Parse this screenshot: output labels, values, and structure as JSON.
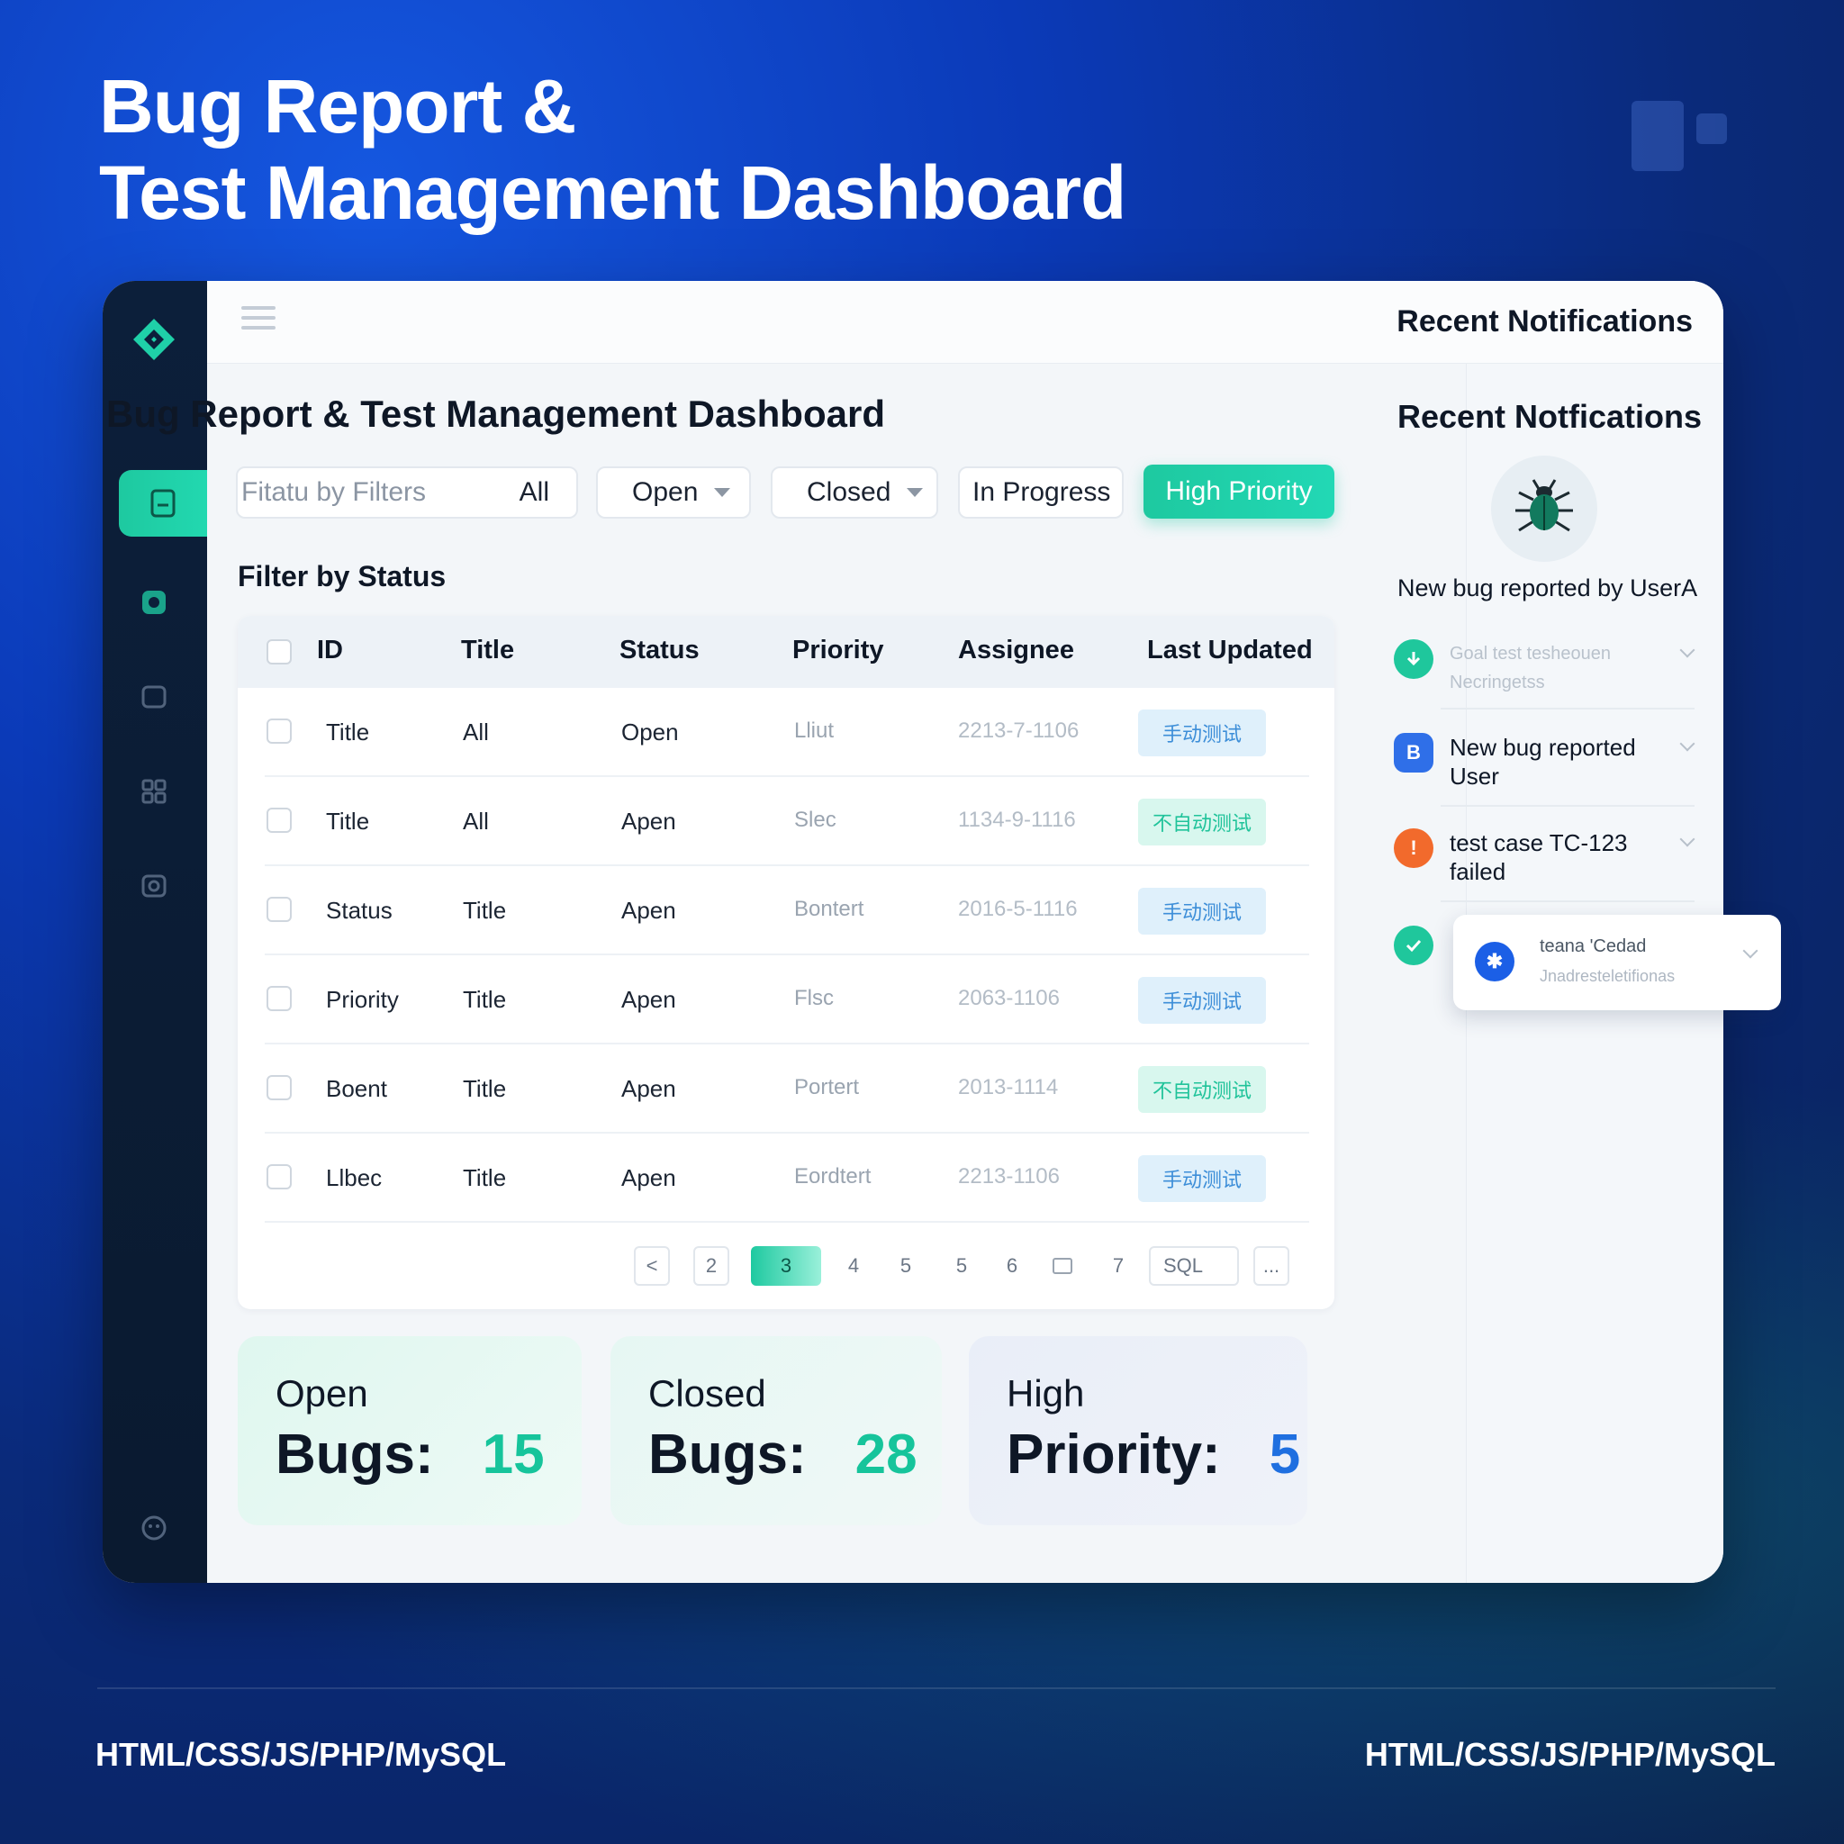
{
  "poster": {
    "title_line1": "Bug Report &",
    "title_line2": "Test Management Dashboard",
    "footer_left": "HTML/CSS/JS/PHP/MySQL",
    "footer_right": "HTML/CSS/JS/PHP/MySQL"
  },
  "topbar": {
    "notifications_title": "Recent Notifications"
  },
  "main": {
    "title": "Bug Report & Test Management Dashboard",
    "filters": {
      "search_placeholder": "Fitatu by Filters",
      "all": "All",
      "open": "Open",
      "closed": "Closed",
      "in_progress": "In Progress",
      "high_priority": "High Priority"
    },
    "section_label": "Filter by Status",
    "table": {
      "headers": [
        "ID",
        "Title",
        "Status",
        "Priority",
        "Assignee",
        "Last Updated"
      ],
      "rows": [
        {
          "id": "Title",
          "title": "All",
          "status": "Open",
          "priority": "Lliut",
          "assignee": "2213-7-1106",
          "updated": "手动测试",
          "badge": "blue"
        },
        {
          "id": "Title",
          "title": "All",
          "status": "Apen",
          "priority": "Slec",
          "assignee": "1134-9-1116",
          "updated": "不自动测试",
          "badge": "green"
        },
        {
          "id": "Status",
          "title": "Title",
          "status": "Apen",
          "priority": "Bontert",
          "assignee": "2016-5-1116",
          "updated": "手动测试",
          "badge": "blue"
        },
        {
          "id": "Priority",
          "title": "Title",
          "status": "Apen",
          "priority": "Flsc",
          "assignee": "2063-1106",
          "updated": "手动测试",
          "badge": "blue"
        },
        {
          "id": "Boent",
          "title": "Title",
          "status": "Apen",
          "priority": "Portert",
          "assignee": "2013-1114",
          "updated": "不自动测试",
          "badge": "green"
        },
        {
          "id": "Llbec",
          "title": "Title",
          "status": "Apen",
          "priority": "Eordtert",
          "assignee": "2213-1106",
          "updated": "手动测试",
          "badge": "blue"
        }
      ]
    },
    "pagination": {
      "prev": "<",
      "pages": [
        "2",
        "3",
        "4",
        "5",
        "5",
        "6",
        "7"
      ],
      "active": "3",
      "jump": "SQL",
      "more": "..."
    },
    "stats": [
      {
        "label": "Open",
        "key": "Bugs:",
        "value": "15",
        "color": "#16c49b"
      },
      {
        "label": "Closed",
        "key": "Bugs:",
        "value": "28",
        "color": "#16c49b"
      },
      {
        "label": "High",
        "key": "Priority:",
        "value": "5",
        "color": "#1f6fe0"
      }
    ]
  },
  "notifications": {
    "title": "Recent Notfications",
    "lead": "New bug reported by UserA",
    "items": [
      {
        "line1": "Goal test tesheouen",
        "line2": "Necringetss",
        "icon": "download-check-icon"
      },
      {
        "line1": "New bug reported",
        "line2": "User",
        "icon": "bug-icon"
      },
      {
        "line1": "test case TC-123",
        "line2": "failed",
        "icon": "alert-icon"
      }
    ],
    "floating": {
      "line1": "teana 'Cedad",
      "line2": "Jnadresteletifionas"
    }
  }
}
